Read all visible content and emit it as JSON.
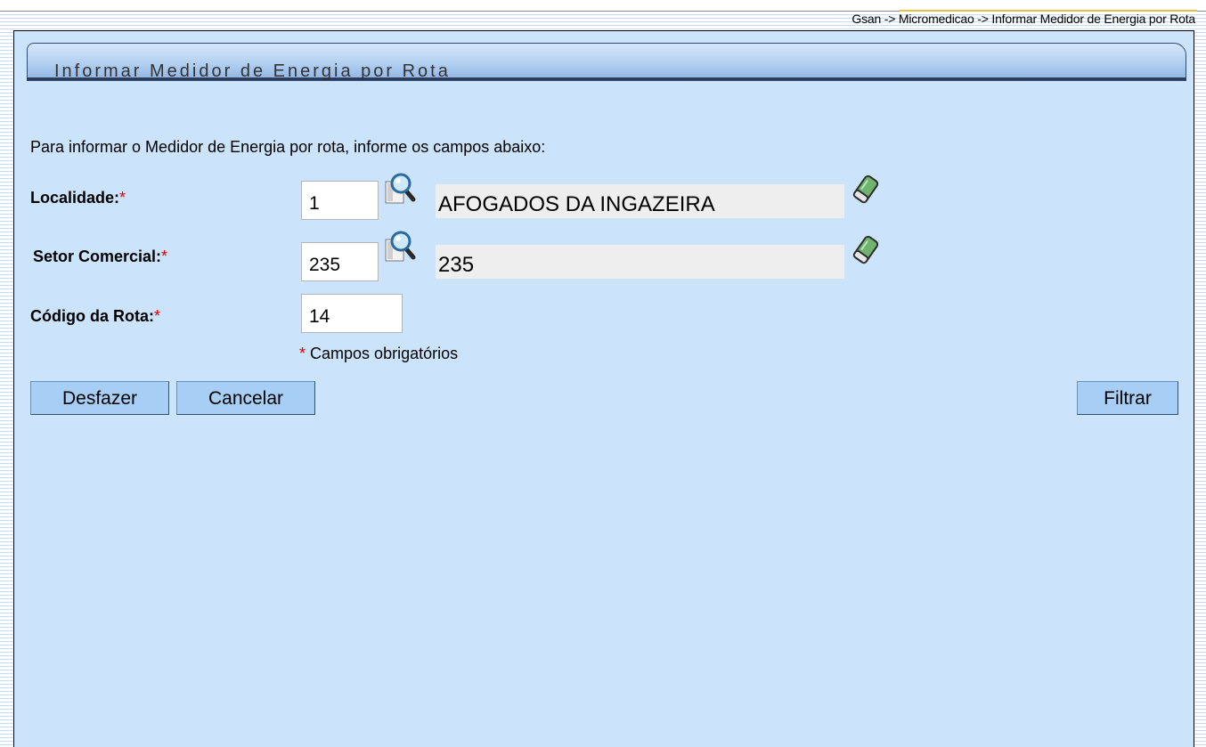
{
  "breadcrumb": "Gsan -> Micromedicao -> Informar Medidor de Energia por Rota",
  "title": "Informar Medidor de Energia por Rota",
  "intro": "Para informar o Medidor de Energia por rota, informe os campos abaixo:",
  "required_marker": "*",
  "fields": {
    "localidade": {
      "label": "Localidade:",
      "value": "1",
      "description": "AFOGADOS DA INGAZEIRA"
    },
    "setor": {
      "label": "Setor Comercial:",
      "value": "235",
      "description": "235"
    },
    "rota": {
      "label": "Código da Rota:",
      "value": "14"
    }
  },
  "required_note": "Campos obrigatórios",
  "buttons": {
    "undo": "Desfazer",
    "cancel": "Cancelar",
    "filter": "Filtrar"
  },
  "colors": {
    "page_bg": "#cce4fb",
    "required": "#e00000",
    "button": "#a7cef4"
  },
  "icons": {
    "search": "search-magnifier-icon",
    "clear": "eraser-icon"
  }
}
